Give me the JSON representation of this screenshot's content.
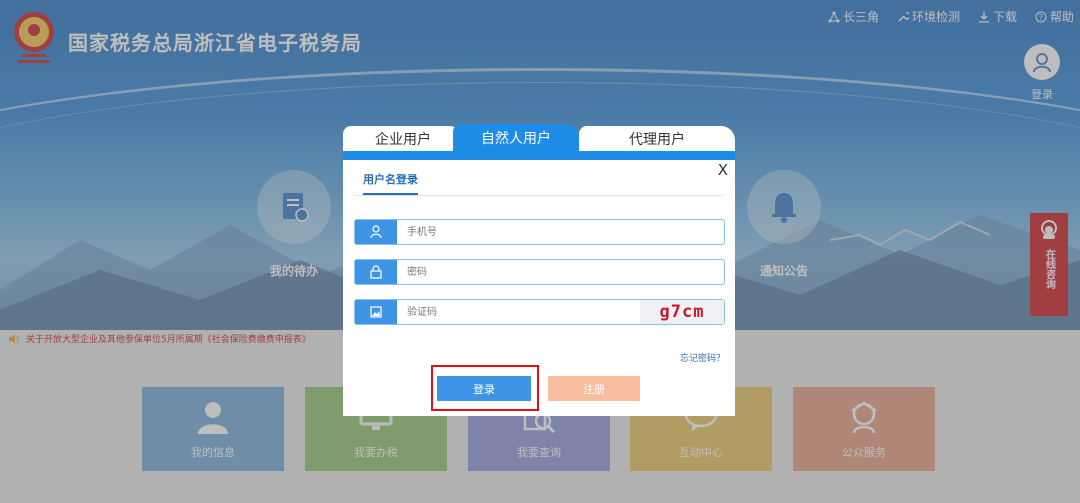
{
  "header": {
    "site_title": "国家税务总局浙江省电子税务局",
    "links": [
      {
        "label": "长三角",
        "icon": "network-icon"
      },
      {
        "label": "环境检测",
        "icon": "wrench-icon"
      },
      {
        "label": "下载",
        "icon": "download-icon"
      },
      {
        "label": "帮助",
        "icon": "help-icon"
      }
    ],
    "login_label": "登录"
  },
  "hero": {
    "todo_label": "我的待办",
    "notice_label": "通知公告"
  },
  "consult": {
    "label": "在线咨询"
  },
  "notice_bar": {
    "text": "关于开放大型企业及其他参保单位5月所属期《社会保险费缴费申报表》"
  },
  "cards": [
    {
      "label": "我的信息",
      "color": "#6fa6d8",
      "icon": "user-icon"
    },
    {
      "label": "我要办税",
      "color": "#8fc06a",
      "icon": "monitor-icon"
    },
    {
      "label": "我要查询",
      "color": "#8c93d9",
      "icon": "search-icon"
    },
    {
      "label": "互动中心",
      "color": "#e8c15a",
      "icon": "chat-icon"
    },
    {
      "label": "公众服务",
      "color": "#e59a7e",
      "icon": "service-icon"
    }
  ],
  "login_modal": {
    "tabs": [
      "企业用户",
      "自然人用户",
      "代理用户"
    ],
    "active_tab": "自然人用户",
    "close_label": "X",
    "subtab": "用户名登录",
    "phone_placeholder": "手机号",
    "password_placeholder": "密码",
    "captcha_placeholder": "验证码",
    "captcha_text": "g7cm",
    "forgot_label": "忘记密码？",
    "login_button": "登录",
    "register_button": "注册"
  },
  "colors": {
    "accent": "#1f8de6",
    "highlight": "#e0101a",
    "consult": "#c8161d"
  }
}
